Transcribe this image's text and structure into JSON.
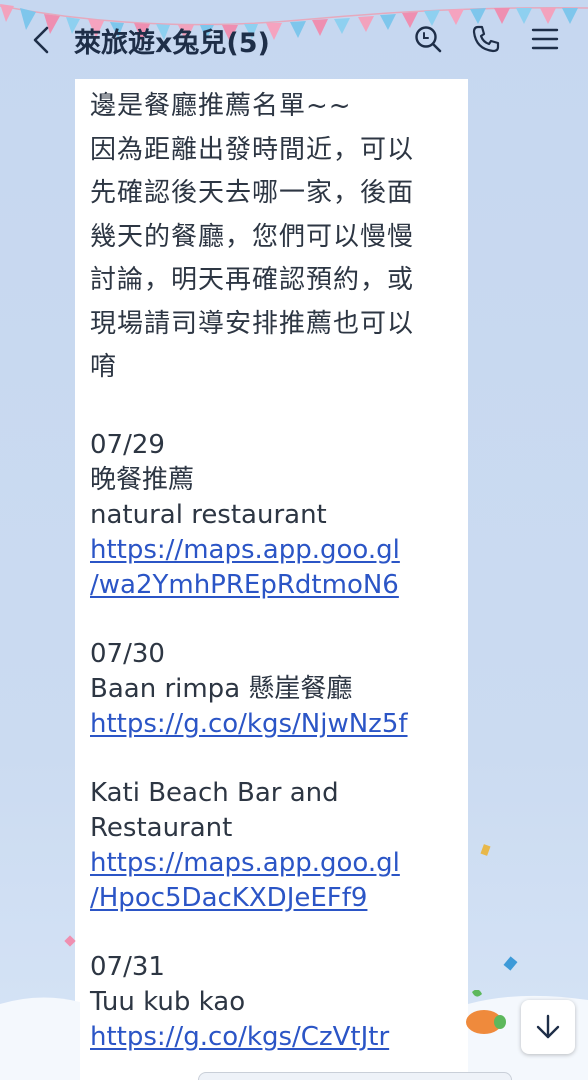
{
  "header": {
    "title": "萊旅遊x兔兒(5)",
    "back_icon": "chevron-left-icon",
    "search_icon": "search-icon",
    "call_icon": "phone-icon",
    "menu_icon": "menu-icon"
  },
  "message": {
    "intro_lines": [
      "邊是餐廳推薦名單~~",
      "因為距離出發時間近，可以",
      "先確認後天去哪一家，後面",
      "幾天的餐廳，您們可以慢慢",
      "討論，明天再確認預約，或",
      "現場請司導安排推薦也可以",
      "唷"
    ],
    "day1": {
      "date": "07/29",
      "label": "晚餐推薦",
      "name": "natural restaurant",
      "link_line1": "https://maps.app.goo.gl",
      "link_line2": "/wa2YmhPREpRdtmoN6"
    },
    "day2": {
      "date": "07/30",
      "name": "Baan rimpa 懸崖餐廳",
      "link": "https://g.co/kgs/NjwNz5f",
      "name2_line1": "Kati Beach Bar and",
      "name2_line2": "Restaurant",
      "link2_line1": "https://maps.app.goo.gl",
      "link2_line2": "/Hpoc5DacKXDJeEFf9"
    },
    "day3": {
      "date": "07/31",
      "name": "Tuu kub kao",
      "link": "https://g.co/kgs/CzVtJtr"
    }
  },
  "scroll_button_icon": "arrow-down-icon",
  "colors": {
    "background": "#c9d9ef",
    "bubble": "#ffffff",
    "link": "#2b55c6",
    "title": "#1e2e48"
  }
}
